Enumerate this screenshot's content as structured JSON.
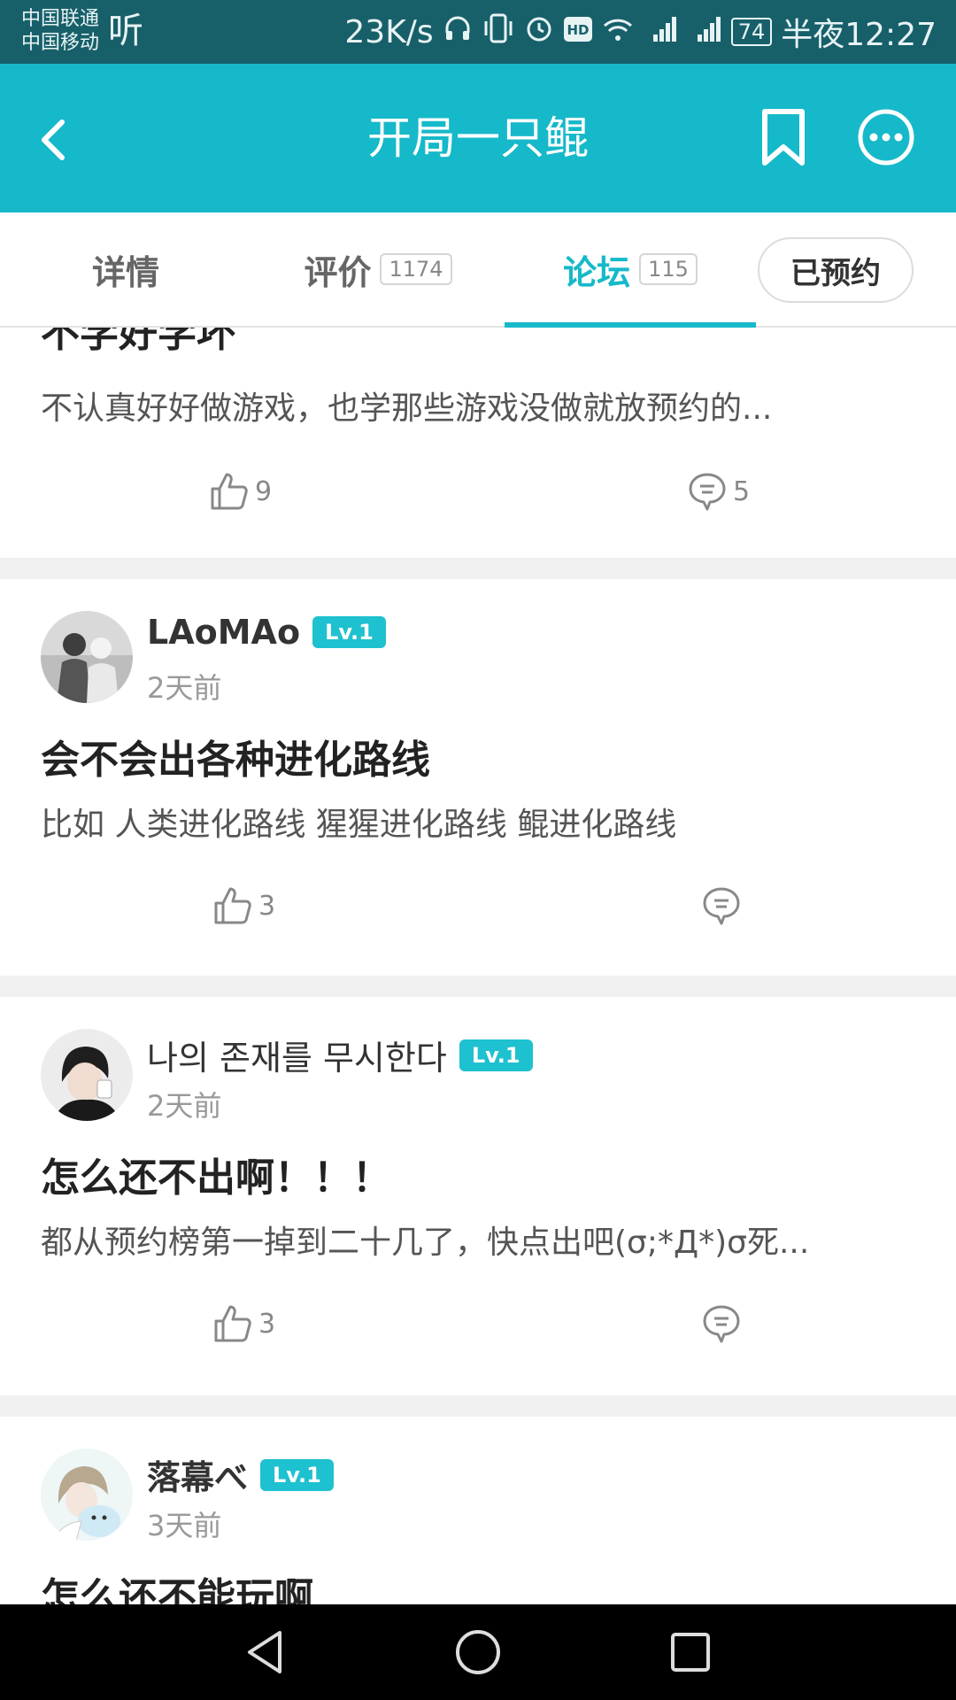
{
  "status_bar": {
    "carrier1": "中国联通",
    "carrier2": "中国移动",
    "listen": "听",
    "speed": "23K/s",
    "battery": "74",
    "time": "半夜12:27"
  },
  "header": {
    "title": "开局一只鲲"
  },
  "tabs": {
    "details": "详情",
    "reviews": "评价",
    "reviews_count": "1174",
    "forum": "论坛",
    "forum_count": "115",
    "reserved": "已预约"
  },
  "posts": [
    {
      "title": "不学好学坏",
      "body": "不认真好好做游戏，也学那些游戏没做就放预约的...",
      "likes": "9",
      "comments": "5"
    },
    {
      "user": "LAoMAo",
      "level": "Lv.1",
      "time": "2天前",
      "title": "会不会出各种进化路线",
      "body": "比如 人类进化路线      猩猩进化路线   鲲进化路线",
      "likes": "3",
      "comments": ""
    },
    {
      "user": "나의 존재를 무시한다",
      "level": "Lv.1",
      "time": "2天前",
      "title": "怎么还不出啊！！！",
      "body": "都从预约榜第一掉到二十几了，快点出吧(σ;*Д*)σ死...",
      "likes": "3",
      "comments": ""
    },
    {
      "user": "落幕べ",
      "level": "Lv.1",
      "time": "3天前",
      "title": "怎么还不能玩啊"
    }
  ],
  "colors": {
    "accent": "#16b9c9",
    "status_bar": "#17606a"
  }
}
